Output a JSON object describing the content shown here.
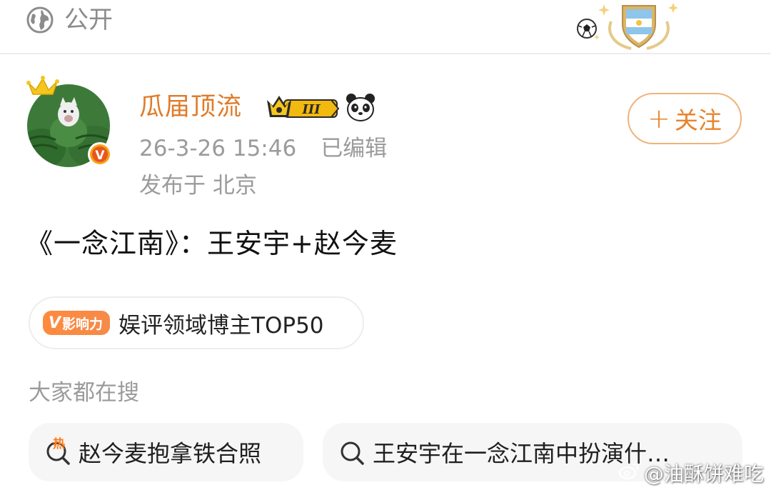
{
  "header": {
    "privacy_label": "公开",
    "privacy_icon": "globe-icon"
  },
  "author": {
    "name": "瓜届顶流",
    "timestamp": "26-3-26 15:46",
    "edited_label": "已编辑",
    "location_prefix": "发布于",
    "location": "北京",
    "level_badge": "III",
    "verified_mark": "V",
    "follow_label": "关注",
    "follow_icon": "+"
  },
  "post": {
    "text": "《一念江南》：王安宇+赵今麦"
  },
  "influence": {
    "badge_v": "V",
    "badge_label": "影响力",
    "text": "娱评领域博主TOP50"
  },
  "search": {
    "heading": "大家都在搜",
    "chips": [
      {
        "label": "赵今麦抱拿铁合照",
        "icon": "hot-search-icon",
        "hot_mark": "热"
      },
      {
        "label": "王安宇在一念江南中扮演什…",
        "icon": "search-icon"
      }
    ]
  },
  "watermark": {
    "text": "@油酥饼难吃"
  },
  "colors": {
    "accent": "#e8832d",
    "muted": "#9b9b9b",
    "chip_bg": "#f6f6f6"
  }
}
